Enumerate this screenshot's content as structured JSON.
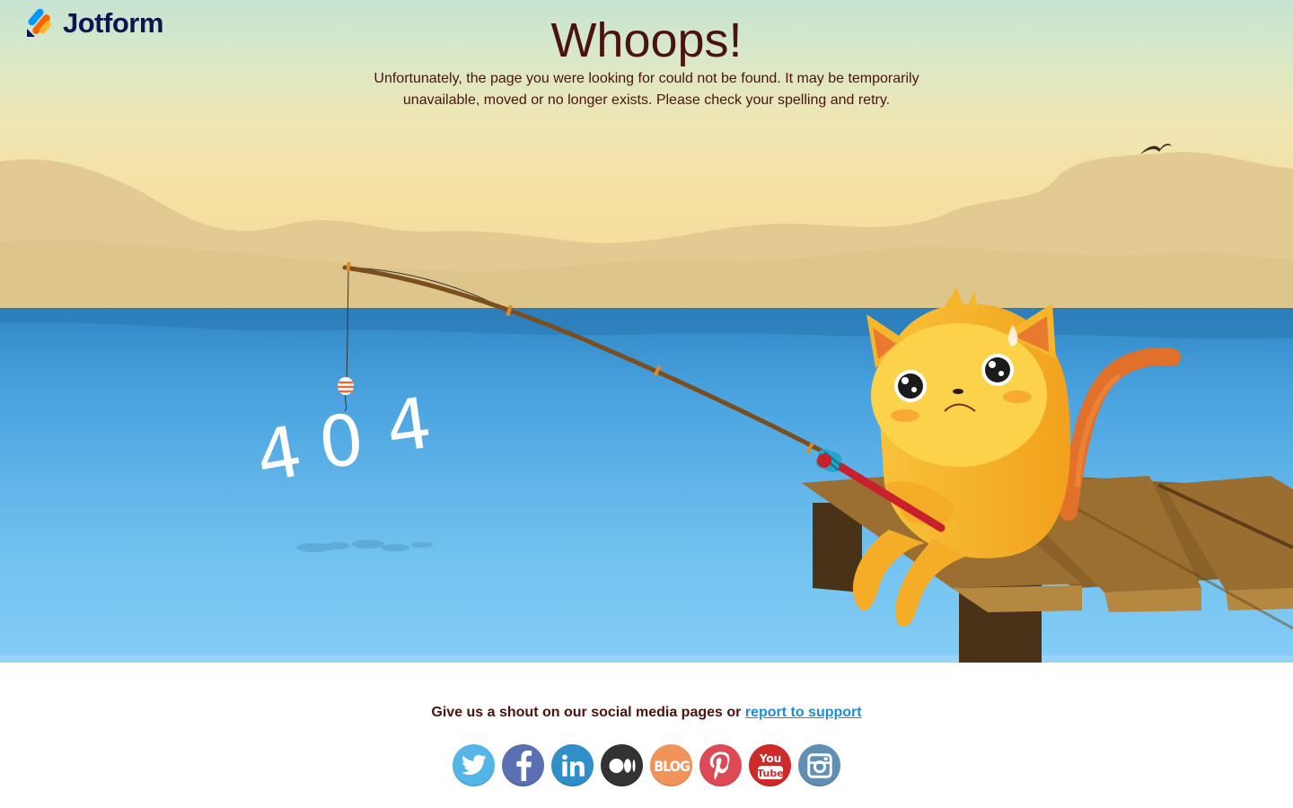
{
  "brand": {
    "name": "Jotform"
  },
  "error": {
    "title": "Whoops!",
    "message": "Unfortunately, the page you were looking for could not be found. It may be temporarily unavailable, moved or no longer exists. Please check your spelling and retry.",
    "code_digits": [
      "4",
      "0",
      "4"
    ]
  },
  "footer": {
    "shout_text": "Give us a shout on our social media pages or",
    "support_link": "report to support",
    "social": [
      {
        "name": "twitter",
        "icon": "twitter-icon",
        "color": "#55b5e6"
      },
      {
        "name": "facebook",
        "icon": "facebook-icon",
        "color": "#5a70b2"
      },
      {
        "name": "linkedin",
        "icon": "linkedin-icon",
        "color": "#2f8fc9"
      },
      {
        "name": "medium",
        "icon": "medium-icon",
        "color": "#333333"
      },
      {
        "name": "blog",
        "icon": "blog-icon",
        "color": "#f0945a",
        "text": "BLOG"
      },
      {
        "name": "pinterest",
        "icon": "pinterest-icon",
        "color": "#dd4a55"
      },
      {
        "name": "youtube",
        "icon": "youtube-icon",
        "color": "#cf2a2a",
        "text_top": "You",
        "text_bottom": "Tube"
      },
      {
        "name": "instagram",
        "icon": "instagram-icon",
        "color": "#5f8fb4"
      }
    ]
  },
  "colors": {
    "title": "#4a130f",
    "link": "#1a8fd6",
    "brand_navy": "#0a1551",
    "sea": "#5ab0e8",
    "cat": "#f7b22a"
  }
}
